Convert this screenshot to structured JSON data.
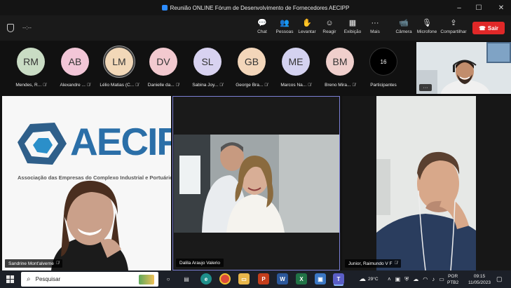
{
  "window": {
    "title": "Reunião ONLINE Fórum de Desenvolvimento de Fornecedores AECIPP",
    "controls": [
      "–",
      "☐",
      "✕"
    ]
  },
  "toolbar": {
    "timer": "--:--",
    "items": [
      {
        "label": "Chat",
        "icon": "chat-icon",
        "glyph": "💬"
      },
      {
        "label": "Pessoas",
        "icon": "people-icon",
        "glyph": "👥"
      },
      {
        "label": "Levantar",
        "icon": "raise-hand-icon",
        "glyph": "✋"
      },
      {
        "label": "Reagir",
        "icon": "react-icon",
        "glyph": "☺"
      },
      {
        "label": "Exibição",
        "icon": "view-icon",
        "glyph": "▦"
      },
      {
        "label": "Mais",
        "icon": "more-icon",
        "glyph": "···"
      },
      {
        "label": "Câmera",
        "icon": "camera-icon",
        "glyph": "📹"
      },
      {
        "label": "Microfone",
        "icon": "microphone-icon",
        "glyph": "🎙"
      },
      {
        "label": "Compartilhar",
        "icon": "share-icon",
        "glyph": "⇪"
      }
    ],
    "leave_label": "Sair"
  },
  "participants": [
    {
      "initials": "RM",
      "name": "Mendes, R...",
      "color": "#c9dcc4"
    },
    {
      "initials": "AB",
      "name": "Alexandre ...",
      "color": "#f2c6d7"
    },
    {
      "initials": "LM",
      "name": "Lélio Matias (C...",
      "color": "#f2d8b8"
    },
    {
      "initials": "DV",
      "name": "Danielle da...",
      "color": "#f2c9cf"
    },
    {
      "initials": "SL",
      "name": "Sabina Joy...",
      "color": "#d8d2f0"
    },
    {
      "initials": "GB",
      "name": "George Bra...",
      "color": "#f3d6ba"
    },
    {
      "initials": "ME",
      "name": "Marcos Na...",
      "color": "#d4d2f0"
    },
    {
      "initials": "BM",
      "name": "Breno Mira...",
      "color": "#efcfcc"
    }
  ],
  "participants_count": "16",
  "participants_label": "Participantes",
  "self_view": {
    "more": "···"
  },
  "videos": [
    {
      "name": "Sandrine Mont'alverne"
    },
    {
      "name": "Dalila Araujo Valerio"
    },
    {
      "name": "Junior, Raimundo V F"
    }
  ],
  "slide": {
    "logo": "AECIPP",
    "subtitle": "Associação das Empresas do Complexo Industrial e Portuário do P"
  },
  "taskbar": {
    "search_placeholder": "Pesquisar",
    "weather": "29°C",
    "language": "POR",
    "layout": "PTB2",
    "time": "09:15",
    "date": "11/05/2023"
  }
}
